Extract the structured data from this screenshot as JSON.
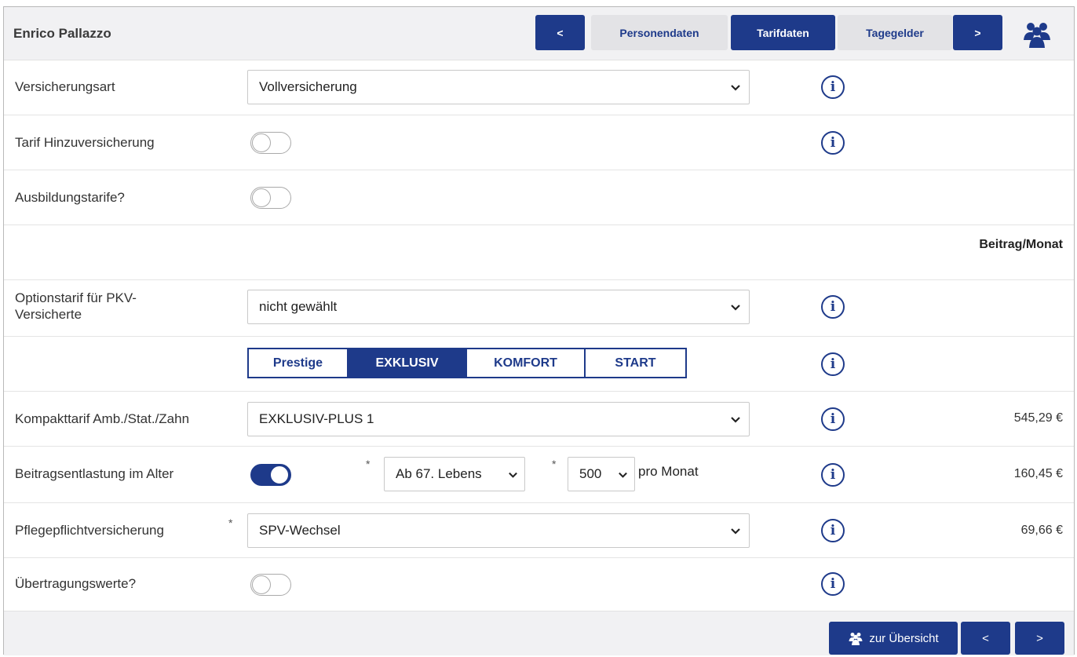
{
  "header": {
    "person_name": "Enrico Pallazzo",
    "nav_prev": "<",
    "tabs": [
      "Personendaten",
      "Tarifdaten",
      "Tagegelder"
    ],
    "active_tab": "Tarifdaten",
    "nav_next": ">",
    "group_icon": "people-group-icon"
  },
  "rows": {
    "versicherungsart": {
      "label": "Versicherungsart",
      "value": "Vollversicherung"
    },
    "hinzuversicherung": {
      "label": "Tarif Hinzuversicherung",
      "toggle_on": false
    },
    "ausbildungstarife": {
      "label": "Ausbildungstarife?",
      "toggle_on": false
    },
    "beitrag_header": "Beitrag/Monat",
    "optionstarif": {
      "label": "Optionstarif für PKV-Versicherte",
      "value": "nicht gewählt"
    },
    "tarif_levels": {
      "options": [
        "Prestige",
        "EXKLUSIV",
        "KOMFORT",
        "START"
      ],
      "selected": "EXKLUSIV"
    },
    "kompakttarif": {
      "label": "Kompakttarif Amb./Stat./Zahn",
      "value": "EXKLUSIV-PLUS 1",
      "price": "545,29 €"
    },
    "beitragsentlastung": {
      "label": "Beitragsentlastung im Alter",
      "toggle_on": true,
      "required_mark": "*",
      "age_value": "Ab 67. Lebens",
      "amount_value": "500",
      "unit_text": "pro Monat",
      "price": "160,45 €"
    },
    "pflegepflicht": {
      "label": "Pflegepflichtversicherung",
      "required_mark": "*",
      "value": "SPV-Wechsel",
      "price": "69,66 €"
    },
    "uebertragungswerte": {
      "label": "Übertragungswerte?",
      "toggle_on": false
    }
  },
  "footer": {
    "overview_label": "zur Übersicht",
    "prev": "<",
    "next": ">"
  },
  "colors": {
    "primary": "#1e3a8a",
    "header_bg": "#f1f1f3",
    "tab_light": "#e3e3e6"
  }
}
